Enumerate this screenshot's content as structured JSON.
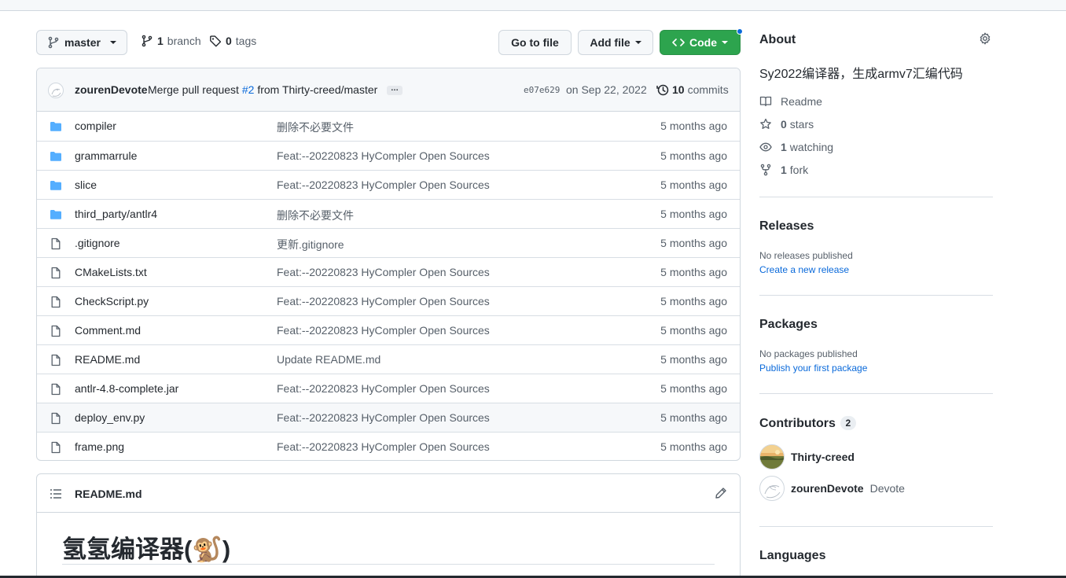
{
  "toolbar": {
    "branch_name": "master",
    "branch_count": "1",
    "branch_label": "branch",
    "tag_count": "0",
    "tag_label": "tags",
    "go_to_file": "Go to file",
    "add_file": "Add file",
    "code": "Code"
  },
  "commit": {
    "author": "zourenDevote",
    "message_pre": "Merge pull request",
    "pr_link": "#2",
    "message_post": "from Thirty-creed/master",
    "ellipsis": "…",
    "sha": "e07e629",
    "date": "on Sep 22, 2022",
    "count": "10",
    "count_label": "commits"
  },
  "files": [
    {
      "type": "dir",
      "name": "compiler",
      "message": "删除不必要文件",
      "age": "5 months ago"
    },
    {
      "type": "dir",
      "name": "grammarrule",
      "message": "Feat:--20220823 HyCompler Open Sources",
      "age": "5 months ago"
    },
    {
      "type": "dir",
      "name": "slice",
      "message": "Feat:--20220823 HyCompler Open Sources",
      "age": "5 months ago"
    },
    {
      "type": "dir",
      "name": "third_party/antlr4",
      "message": "删除不必要文件",
      "age": "5 months ago"
    },
    {
      "type": "file",
      "name": ".gitignore",
      "message": "更新.gitignore",
      "age": "5 months ago"
    },
    {
      "type": "file",
      "name": "CMakeLists.txt",
      "message": "Feat:--20220823 HyCompler Open Sources",
      "age": "5 months ago"
    },
    {
      "type": "file",
      "name": "CheckScript.py",
      "message": "Feat:--20220823 HyCompler Open Sources",
      "age": "5 months ago"
    },
    {
      "type": "file",
      "name": "Comment.md",
      "message": "Feat:--20220823 HyCompler Open Sources",
      "age": "5 months ago"
    },
    {
      "type": "file",
      "name": "README.md",
      "message": "Update README.md",
      "age": "5 months ago"
    },
    {
      "type": "file",
      "name": "antlr-4.8-complete.jar",
      "message": "Feat:--20220823 HyCompler Open Sources",
      "age": "5 months ago"
    },
    {
      "type": "file",
      "name": "deploy_env.py",
      "message": "Feat:--20220823 HyCompler Open Sources",
      "age": "5 months ago"
    },
    {
      "type": "file",
      "name": "frame.png",
      "message": "Feat:--20220823 HyCompler Open Sources",
      "age": "5 months ago"
    }
  ],
  "readme": {
    "filename": "README.md",
    "heading": "氢氢编译器(🐒)"
  },
  "about": {
    "title": "About",
    "description": "Sy2022编译器，生成armv7汇编代码",
    "readme": "Readme",
    "stars_count": "0",
    "stars_label": "stars",
    "watching_count": "1",
    "watching_label": "watching",
    "fork_count": "1",
    "fork_label": "fork"
  },
  "releases": {
    "title": "Releases",
    "empty": "No releases published",
    "link": "Create a new release"
  },
  "packages": {
    "title": "Packages",
    "empty": "No packages published",
    "link": "Publish your first package"
  },
  "contributors": {
    "title": "Contributors",
    "count": "2",
    "people": [
      {
        "login": "Thirty-creed",
        "name": ""
      },
      {
        "login": "zourenDevote",
        "name": "Devote"
      }
    ]
  },
  "languages": {
    "title": "Languages"
  },
  "colors": {
    "accent": "#0969da",
    "code_button": "#2da44e",
    "folder": "#54aeff",
    "border": "#d0d7de"
  }
}
